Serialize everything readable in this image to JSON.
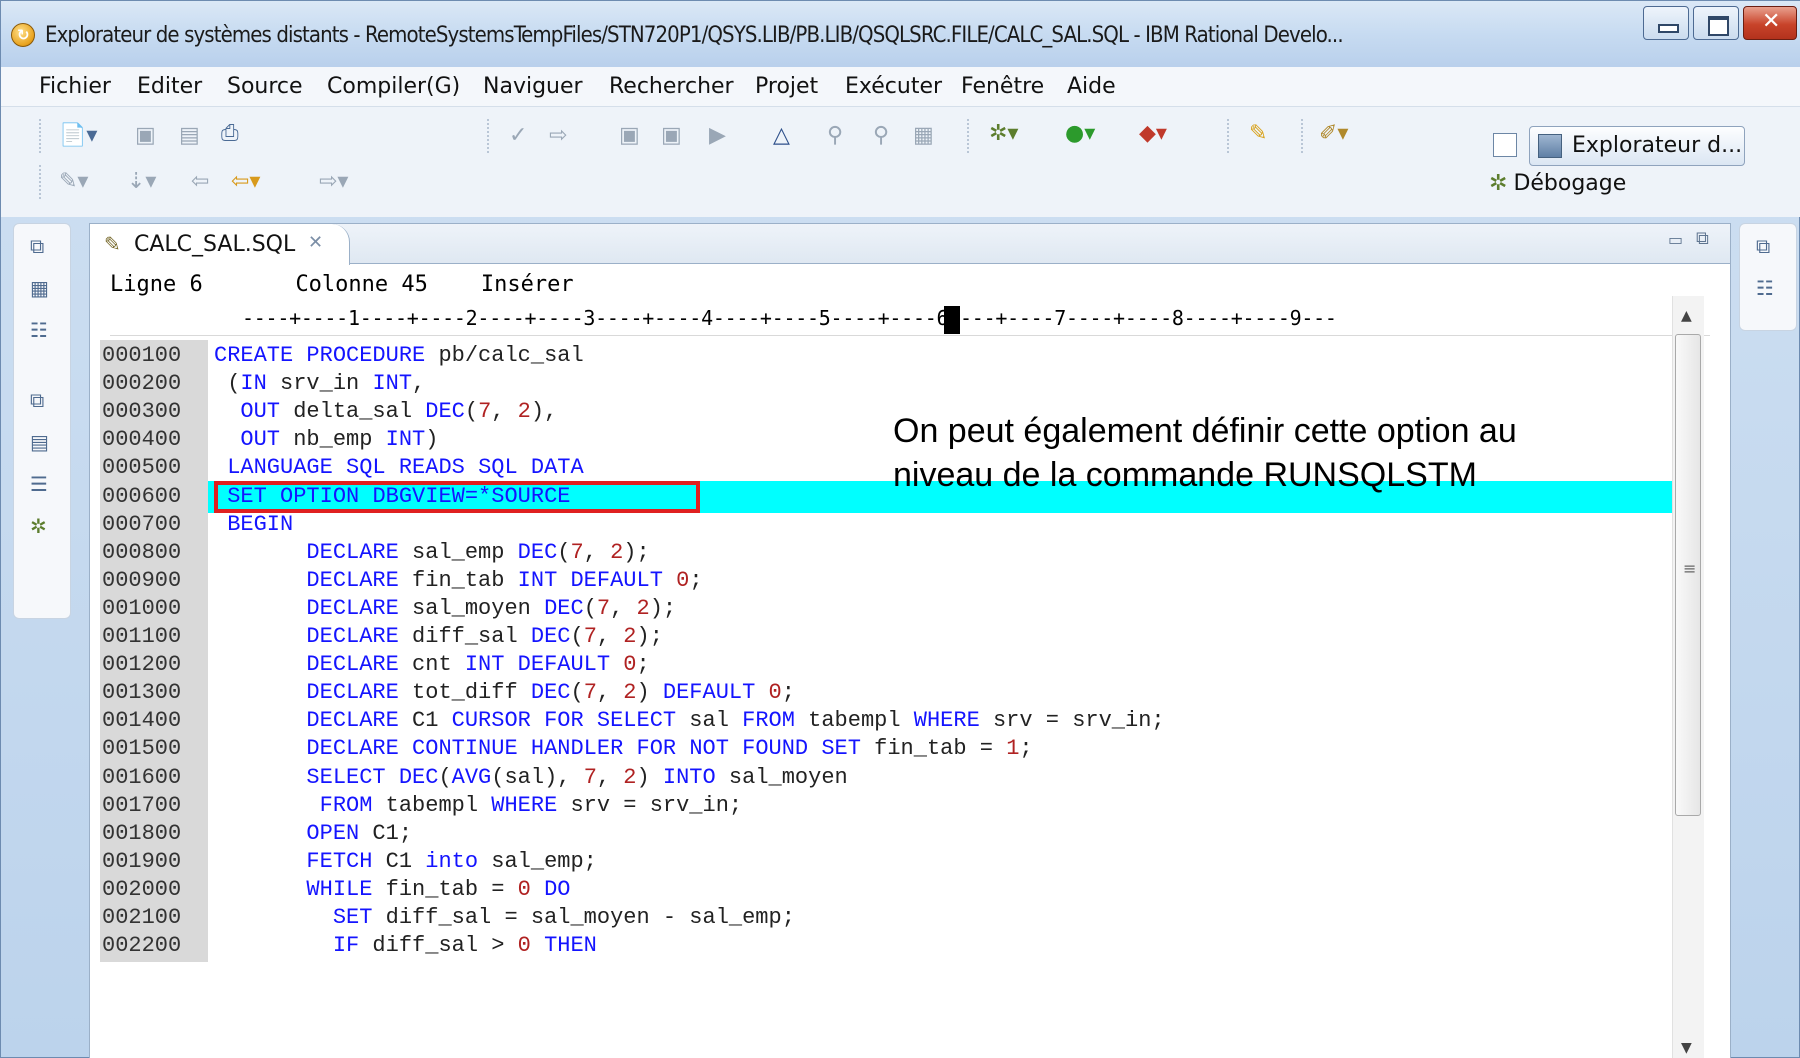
{
  "window": {
    "title": "Explorateur de systèmes distants - RemoteSystemsTempFiles/STN720P1/QSYS.LIB/PB.LIB/QSQLSRC.FILE/CALC_SAL.SQL - IBM Rational Develo..."
  },
  "menu": [
    {
      "label": "Fichier"
    },
    {
      "label": "Editer"
    },
    {
      "label": "Source"
    },
    {
      "label": "Compiler(G)"
    },
    {
      "label": "Naviguer"
    },
    {
      "label": "Rechercher"
    },
    {
      "label": "Projet"
    },
    {
      "label": "Exécuter"
    },
    {
      "label": "Fenêtre"
    },
    {
      "label": "Aide"
    }
  ],
  "toolbar": {
    "perspective_label": "Explorateur d...",
    "debug_label": "Débogage"
  },
  "editor": {
    "tab_label": "CALC_SAL.SQL",
    "status": {
      "line_label": "Ligne 6",
      "column_label": "Colonne 45",
      "mode_label": "Insérer"
    },
    "ruler": "----+----1----+----2----+----3----+----4----+----5----+----6----+----7----+----8----+----9---",
    "lines": [
      {
        "no": "000100",
        "code": "CREATE PROCEDURE pb/calc_sal"
      },
      {
        "no": "000200",
        "code": " (IN srv_in INT,"
      },
      {
        "no": "000300",
        "code": "  OUT delta_sal DEC(7, 2),"
      },
      {
        "no": "000400",
        "code": "  OUT nb_emp INT)"
      },
      {
        "no": "000500",
        "code": " LANGUAGE SQL READS SQL DATA"
      },
      {
        "no": "000600",
        "code": " SET OPTION DBGVIEW=*SOURCE"
      },
      {
        "no": "000700",
        "code": " BEGIN"
      },
      {
        "no": "000800",
        "code": "       DECLARE sal_emp DEC(7, 2);"
      },
      {
        "no": "000900",
        "code": "       DECLARE fin_tab INT DEFAULT 0;"
      },
      {
        "no": "001000",
        "code": "       DECLARE sal_moyen DEC(7, 2);"
      },
      {
        "no": "001100",
        "code": "       DECLARE diff_sal DEC(7, 2);"
      },
      {
        "no": "001200",
        "code": "       DECLARE cnt INT DEFAULT 0;"
      },
      {
        "no": "001300",
        "code": "       DECLARE tot_diff DEC(7, 2) DEFAULT 0;"
      },
      {
        "no": "001400",
        "code": "       DECLARE C1 CURSOR FOR SELECT sal FROM tabempl WHERE srv = srv_in;"
      },
      {
        "no": "001500",
        "code": "       DECLARE CONTINUE HANDLER FOR NOT FOUND SET fin_tab = 1;"
      },
      {
        "no": "001600",
        "code": "       SELECT DEC(AVG(sal), 7, 2) INTO sal_moyen"
      },
      {
        "no": "001700",
        "code": "        FROM tabempl WHERE srv = srv_in;"
      },
      {
        "no": "001800",
        "code": "       OPEN C1;"
      },
      {
        "no": "001900",
        "code": "       FETCH C1 into sal_emp;"
      },
      {
        "no": "002000",
        "code": "       WHILE fin_tab = 0 DO"
      },
      {
        "no": "002100",
        "code": "         SET diff_sal = sal_moyen - sal_emp;"
      },
      {
        "no": "002200",
        "code": "         IF diff_sal > 0 THEN"
      }
    ],
    "highlighted_line": "000600"
  },
  "annotation": {
    "line1": "On peut également définir cette option au",
    "line2": "niveau de la commande RUNSQLSTM"
  },
  "colors": {
    "keyword": "#1414ff",
    "number": "#b02222",
    "highlight": "#00ffff",
    "annotation_box": "#e02020"
  }
}
